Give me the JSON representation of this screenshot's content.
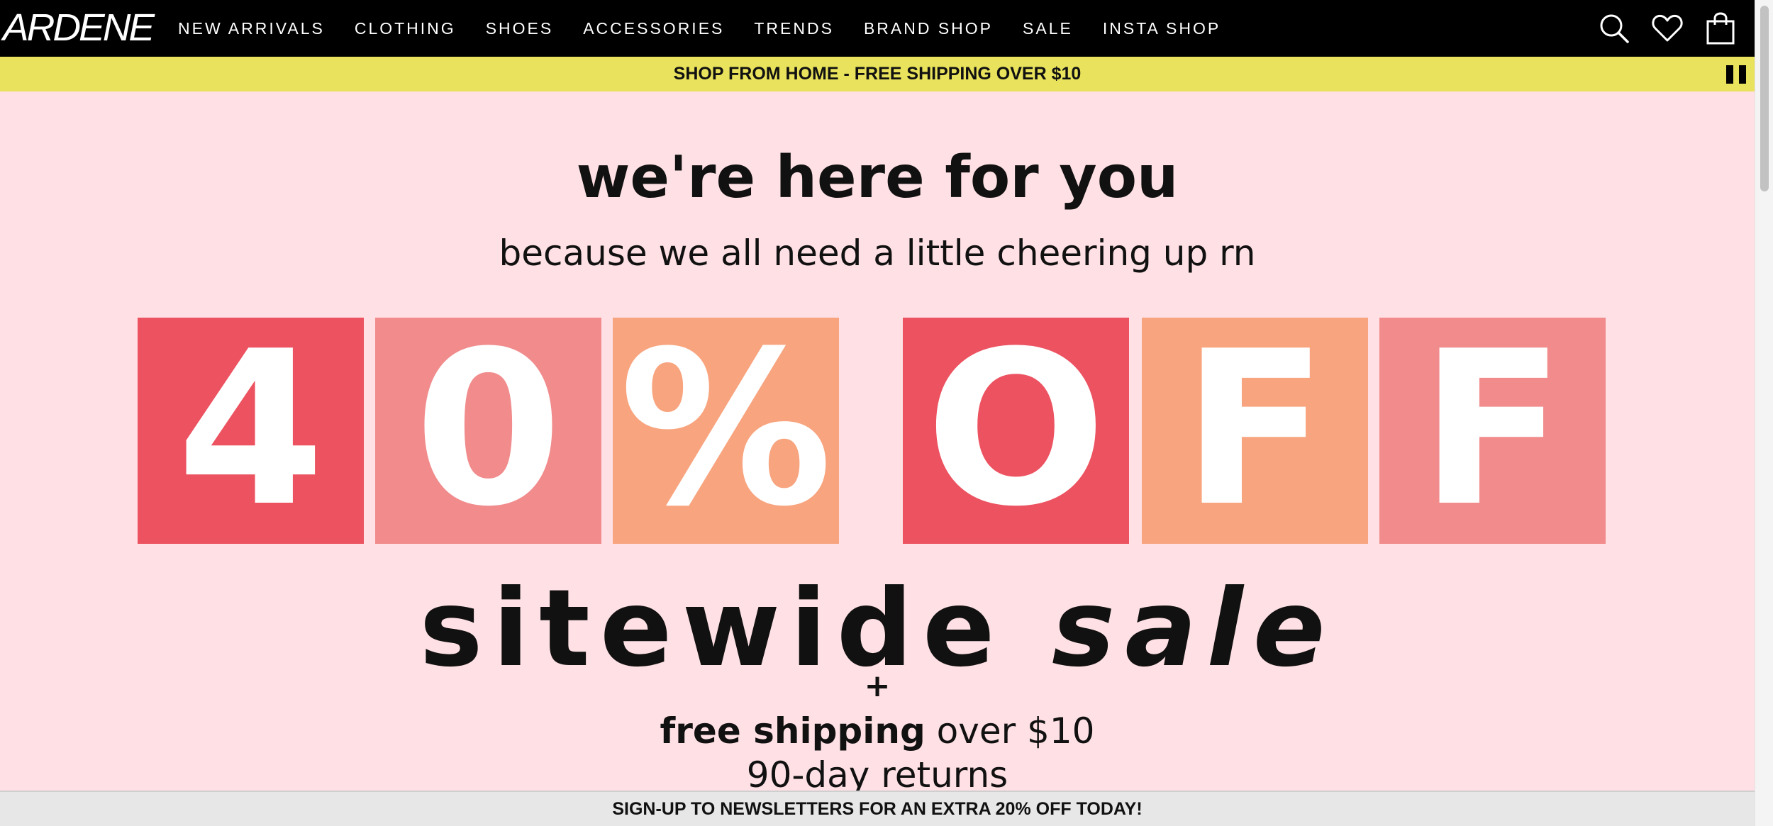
{
  "header": {
    "logo": "ARDENE",
    "nav": [
      {
        "label": "NEW ARRIVALS",
        "name": "nav-new-arrivals"
      },
      {
        "label": "CLOTHING",
        "name": "nav-clothing"
      },
      {
        "label": "SHOES",
        "name": "nav-shoes"
      },
      {
        "label": "ACCESSORIES",
        "name": "nav-accessories"
      },
      {
        "label": "TRENDS",
        "name": "nav-trends"
      },
      {
        "label": "BRAND SHOP",
        "name": "nav-brand-shop"
      },
      {
        "label": "SALE",
        "name": "nav-sale"
      },
      {
        "label": "INSTA SHOP",
        "name": "nav-insta-shop"
      }
    ],
    "icons": [
      "search-icon",
      "heart-icon",
      "shopping-bag-icon"
    ]
  },
  "promo_bar": {
    "text": "SHOP FROM HOME - FREE SHIPPING OVER $10",
    "background": "#e8e25c",
    "control_icon": "pause-icon"
  },
  "hero": {
    "headline": "we're here for you",
    "subheadline": "because we all need a little cheering up rn",
    "tiles": [
      {
        "char": "4",
        "color": "#ec5260"
      },
      {
        "char": "0",
        "color": "#f18b8c"
      },
      {
        "char": "%",
        "color": "#f8a47e"
      },
      {
        "char": "O",
        "color": "#ec5260"
      },
      {
        "char": "F",
        "color": "#f8a47e"
      },
      {
        "char": "F",
        "color": "#f18b8c"
      }
    ],
    "sitewide_word": "sitewide",
    "sale_word": "sale",
    "plus": "+",
    "free_shipping_bold": "free shipping",
    "free_shipping_rest": " over $10",
    "returns": "90-day returns",
    "background": "#ffe1e5"
  },
  "newsletter_bar": {
    "text": "SIGN-UP TO NEWSLETTERS FOR AN EXTRA 20% OFF TODAY!"
  }
}
